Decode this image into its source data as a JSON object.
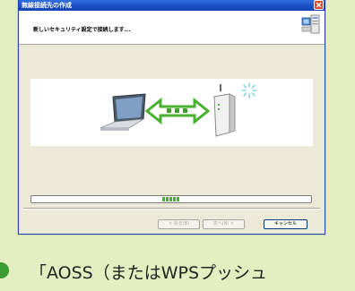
{
  "window": {
    "title": "無線接続先の作成",
    "close_icon": "close-icon"
  },
  "header": {
    "message": "新しいセキュリティ設定で接続します...",
    "icon": "computer-network-icon"
  },
  "illustration": {
    "laptop_icon": "laptop-icon",
    "arrows_icon": "bidirectional-arrows-icon",
    "router_icon": "wireless-router-icon",
    "signal_icon": "wireless-signal-icon"
  },
  "progress": {
    "chunks": 5
  },
  "buttons": {
    "back": "< 戻る(B)",
    "next": "次へ(N) >",
    "cancel": "キャンセル"
  },
  "caption": {
    "text": "「AOSS（またはWPSプッシュ"
  },
  "colors": {
    "page_background": "#e3efc0",
    "title_bar": "#1a4fc6",
    "progress": "#3bbb2c",
    "arrows": "#47b02f"
  }
}
